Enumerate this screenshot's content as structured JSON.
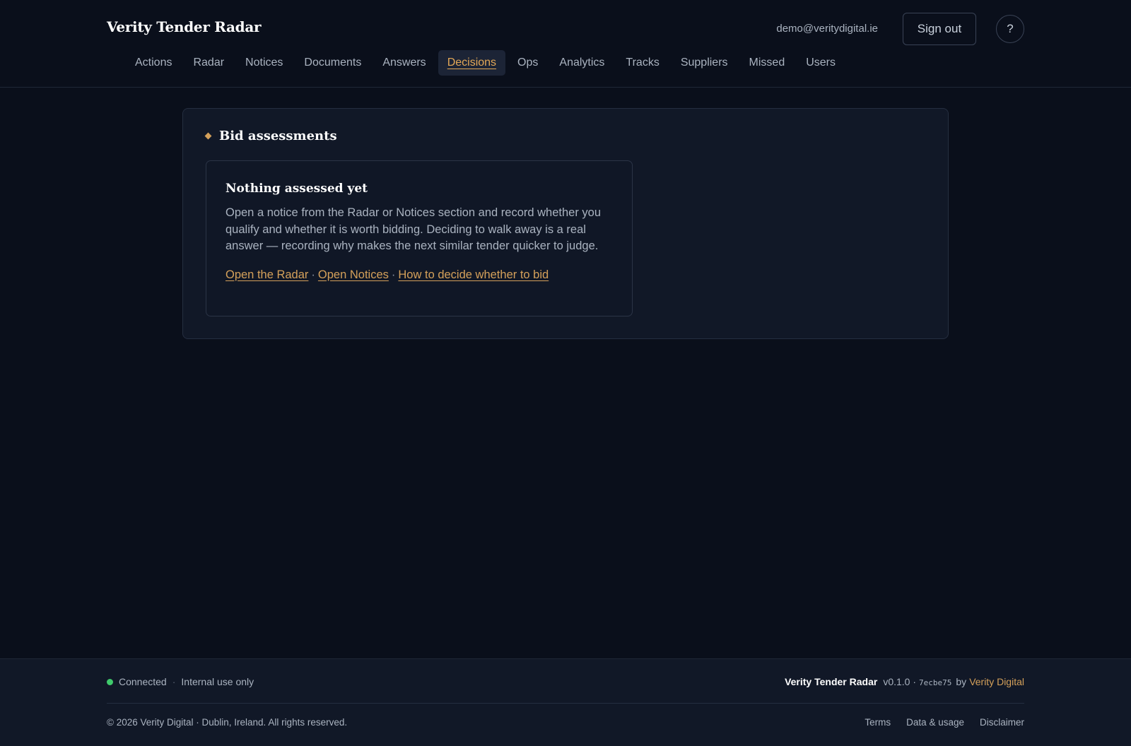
{
  "header": {
    "brand": "Verity Tender Radar",
    "user_email": "demo@veritydigital.ie",
    "sign_out_label": "Sign out",
    "help_label": "?"
  },
  "nav": {
    "items": [
      {
        "label": "Actions"
      },
      {
        "label": "Radar"
      },
      {
        "label": "Notices"
      },
      {
        "label": "Documents"
      },
      {
        "label": "Answers"
      },
      {
        "label": "Decisions"
      },
      {
        "label": "Ops"
      },
      {
        "label": "Analytics"
      },
      {
        "label": "Tracks"
      },
      {
        "label": "Suppliers"
      },
      {
        "label": "Missed"
      },
      {
        "label": "Users"
      }
    ],
    "active": "Decisions"
  },
  "main": {
    "section_title": "Bid assessments",
    "empty_state": {
      "title": "Nothing assessed yet",
      "text": "Open a notice from the Radar or Notices section and record whether you qualify and whether it is worth bidding. Deciding to walk away is a real answer — recording why makes the next similar tender quicker to judge.",
      "links": [
        {
          "label": "Open the Radar"
        },
        {
          "label": "Open Notices"
        },
        {
          "label": "How to decide whether to bid"
        }
      ],
      "link_separator": "·"
    }
  },
  "footer": {
    "status": "Connected",
    "status_separator": "·",
    "usage_note": "Internal use only",
    "brand": "Verity Tender Radar",
    "version": "v0.1.0 ·",
    "commit": "7ecbe75",
    "by": "by",
    "company": "Verity Digital",
    "copyright": "© 2026 Verity Digital · Dublin, Ireland. All rights reserved.",
    "links": [
      {
        "label": "Terms"
      },
      {
        "label": "Data & usage"
      },
      {
        "label": "Disclaimer"
      }
    ]
  },
  "colors": {
    "background": "#0a0f1b",
    "card": "#111827",
    "accent": "#d4a05a",
    "status_ok": "#3fca6b"
  },
  "icons": {
    "section": "diamond-icon",
    "status": "status-dot-icon",
    "help": "help-icon"
  }
}
